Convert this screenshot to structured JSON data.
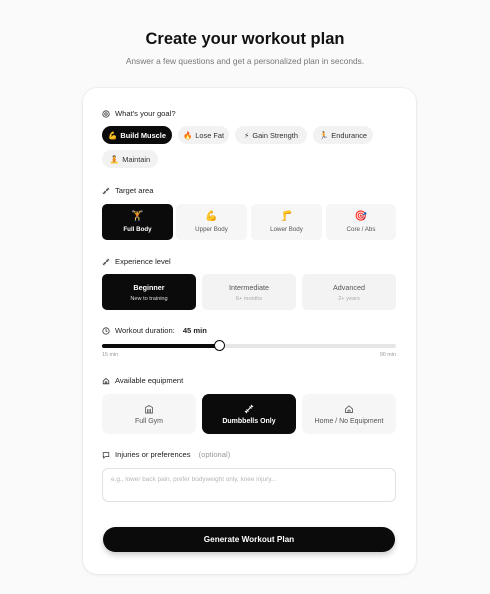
{
  "header": {
    "title": "Create your workout plan",
    "subtitle": "Answer a few questions and get a personalized plan in seconds."
  },
  "goal": {
    "label": "What's your goal?",
    "options": [
      {
        "emoji": "💪",
        "label": "Build Muscle",
        "selected": true
      },
      {
        "emoji": "🔥",
        "label": "Lose Fat",
        "selected": false
      },
      {
        "emoji": "⚡",
        "label": "Gain Strength",
        "selected": false
      },
      {
        "emoji": "🏃",
        "label": "Endurance",
        "selected": false
      },
      {
        "emoji": "🧘",
        "label": "Maintain",
        "selected": false
      }
    ]
  },
  "target": {
    "label": "Target area",
    "options": [
      {
        "emoji": "🏋",
        "label": "Full Body",
        "selected": true
      },
      {
        "emoji": "💪",
        "label": "Upper Body",
        "selected": false
      },
      {
        "emoji": "🦵",
        "label": "Lower Body",
        "selected": false
      },
      {
        "emoji": "🎯",
        "label": "Core / Abs",
        "selected": false
      }
    ]
  },
  "experience": {
    "label": "Experience level",
    "options": [
      {
        "title": "Beginner",
        "subtitle": "New to training",
        "selected": true
      },
      {
        "title": "Intermediate",
        "subtitle": "6+ months",
        "selected": false
      },
      {
        "title": "Advanced",
        "subtitle": "2+ years",
        "selected": false
      }
    ]
  },
  "duration": {
    "label": "Workout duration:",
    "value_text": "45 min",
    "value": 45,
    "min": 15,
    "max": 90,
    "min_label": "15 min",
    "max_label": "90 min"
  },
  "equipment": {
    "label": "Available equipment",
    "options": [
      {
        "icon": "building-icon",
        "label": "Full Gym",
        "selected": false
      },
      {
        "icon": "dumbbell-icon",
        "label": "Dumbbells Only",
        "selected": true
      },
      {
        "icon": "home-icon",
        "label": "Home / No Equipment",
        "selected": false
      }
    ]
  },
  "injuries": {
    "label": "Injuries or preferences",
    "optional": "(optional)",
    "placeholder": "e.g., lower back pain, prefer bodyweight only, knee injury...",
    "value": ""
  },
  "submit": {
    "label": "Generate Workout Plan"
  },
  "colors": {
    "accent": "#0b0b0b",
    "background": "#fafafa",
    "card": "#ffffff",
    "option_bg": "#f2f2f2"
  }
}
